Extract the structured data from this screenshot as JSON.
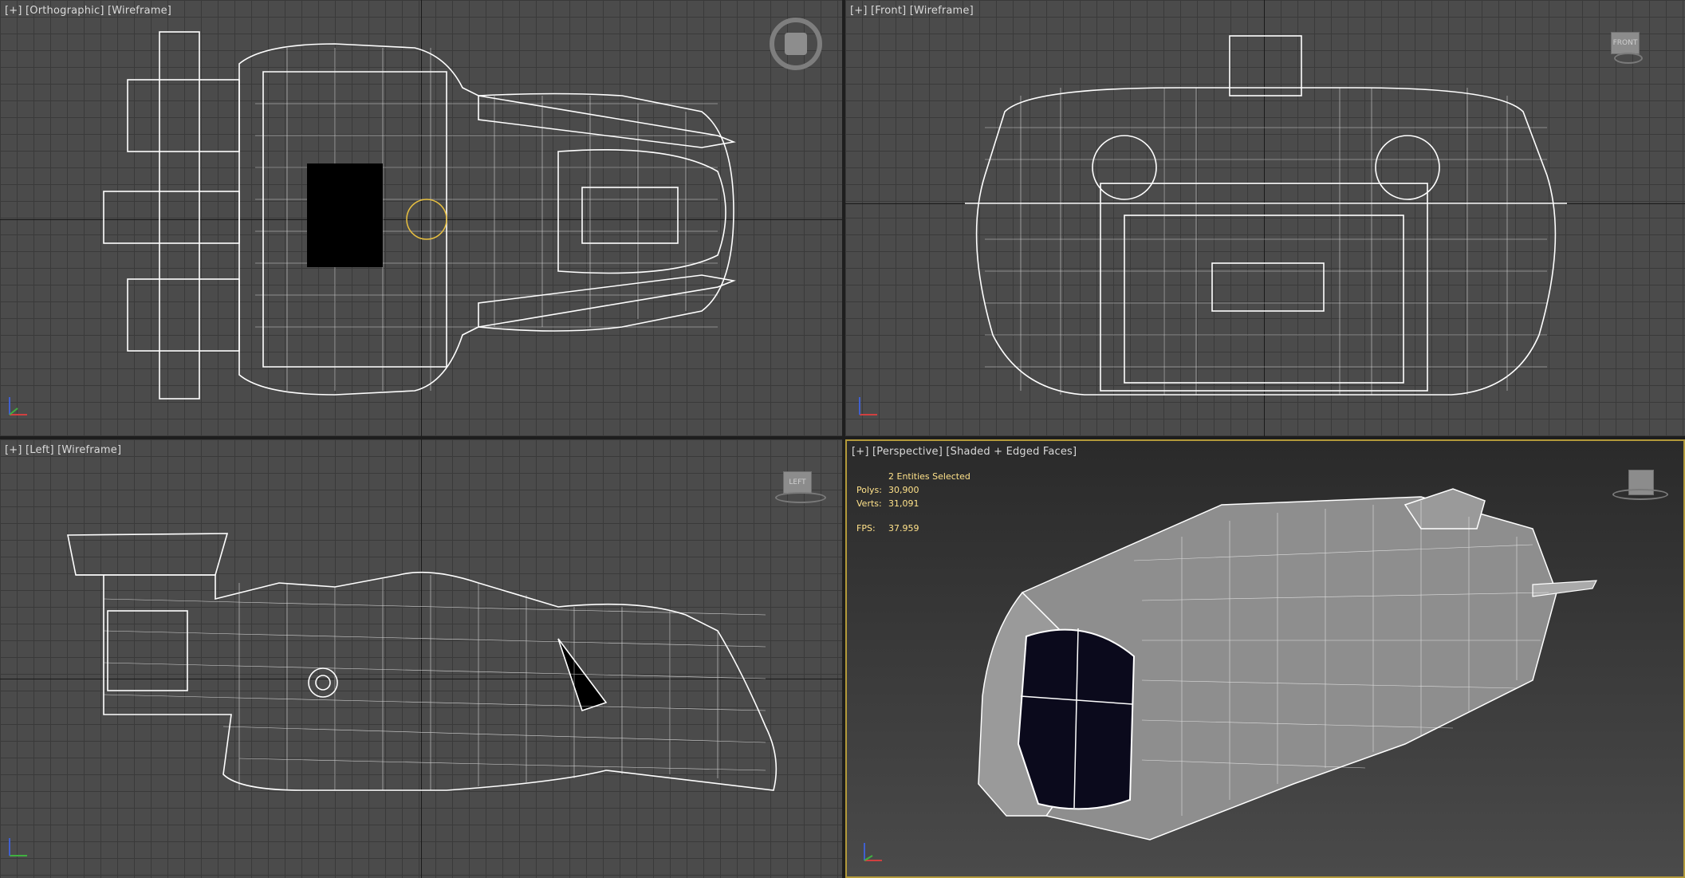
{
  "viewports": {
    "top": {
      "plus": "[+]",
      "view": "[Orthographic]",
      "mode": "[Wireframe]"
    },
    "front": {
      "plus": "[+]",
      "view": "[Front]",
      "mode": "[Wireframe]",
      "cube_label": "FRONT"
    },
    "left": {
      "plus": "[+]",
      "view": "[Left]",
      "mode": "[Wireframe]",
      "cube_label": "LEFT"
    },
    "perspective": {
      "plus": "[+]",
      "view": "[Perspective]",
      "mode": "[Shaded + Edged Faces]"
    }
  },
  "stats": {
    "selected": "2 Entities Selected",
    "polys_label": "Polys:",
    "polys_value": "30,900",
    "verts_label": "Verts:",
    "verts_value": "31,091",
    "fps_label": "FPS:",
    "fps_value": "37.959"
  },
  "colors": {
    "active_border": "#b39a3a",
    "stats_text": "#ffe28a",
    "wireframe": "#ffffff"
  },
  "icons": [
    "viewcube-icon",
    "steering-wheel-icon",
    "axis-gizmo-icon"
  ]
}
